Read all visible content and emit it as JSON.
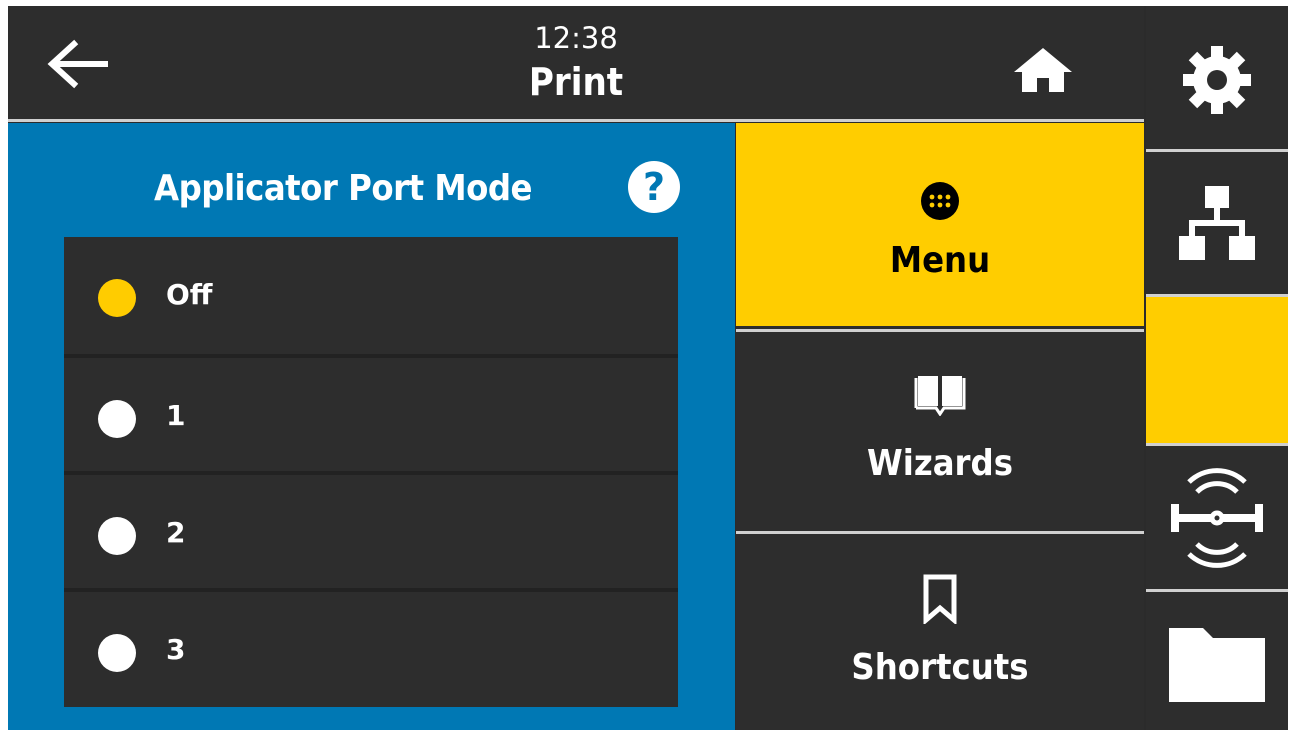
{
  "header": {
    "time": "12:38",
    "title": "Print"
  },
  "panel": {
    "title": "Applicator Port Mode",
    "help_symbol": "?",
    "options": [
      {
        "label": "Off",
        "selected": true
      },
      {
        "label": "1",
        "selected": false
      },
      {
        "label": "2",
        "selected": false
      },
      {
        "label": "3",
        "selected": false
      }
    ]
  },
  "nav": {
    "menu_label": "Menu",
    "wizards_label": "Wizards",
    "shortcuts_label": "Shortcuts"
  },
  "side": {
    "icons": [
      "gear-icon",
      "network-icon",
      "print-active",
      "wireless-antenna-icon",
      "folder-icon"
    ]
  },
  "colors": {
    "accent_yellow": "#ffcd00",
    "panel_blue": "#0078b4",
    "dark_bg": "#2d2d2d"
  }
}
